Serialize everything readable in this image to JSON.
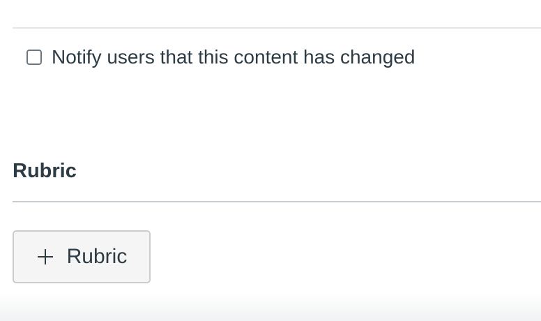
{
  "notify": {
    "label": "Notify users that this content has changed",
    "checked": false
  },
  "rubric_section": {
    "heading": "Rubric",
    "add_button_label": "Rubric",
    "add_button_icon": "plus-icon"
  },
  "colors": {
    "text": "#2d3b45",
    "divider": "#c7cdd1",
    "button_bg": "#f5f5f5"
  }
}
